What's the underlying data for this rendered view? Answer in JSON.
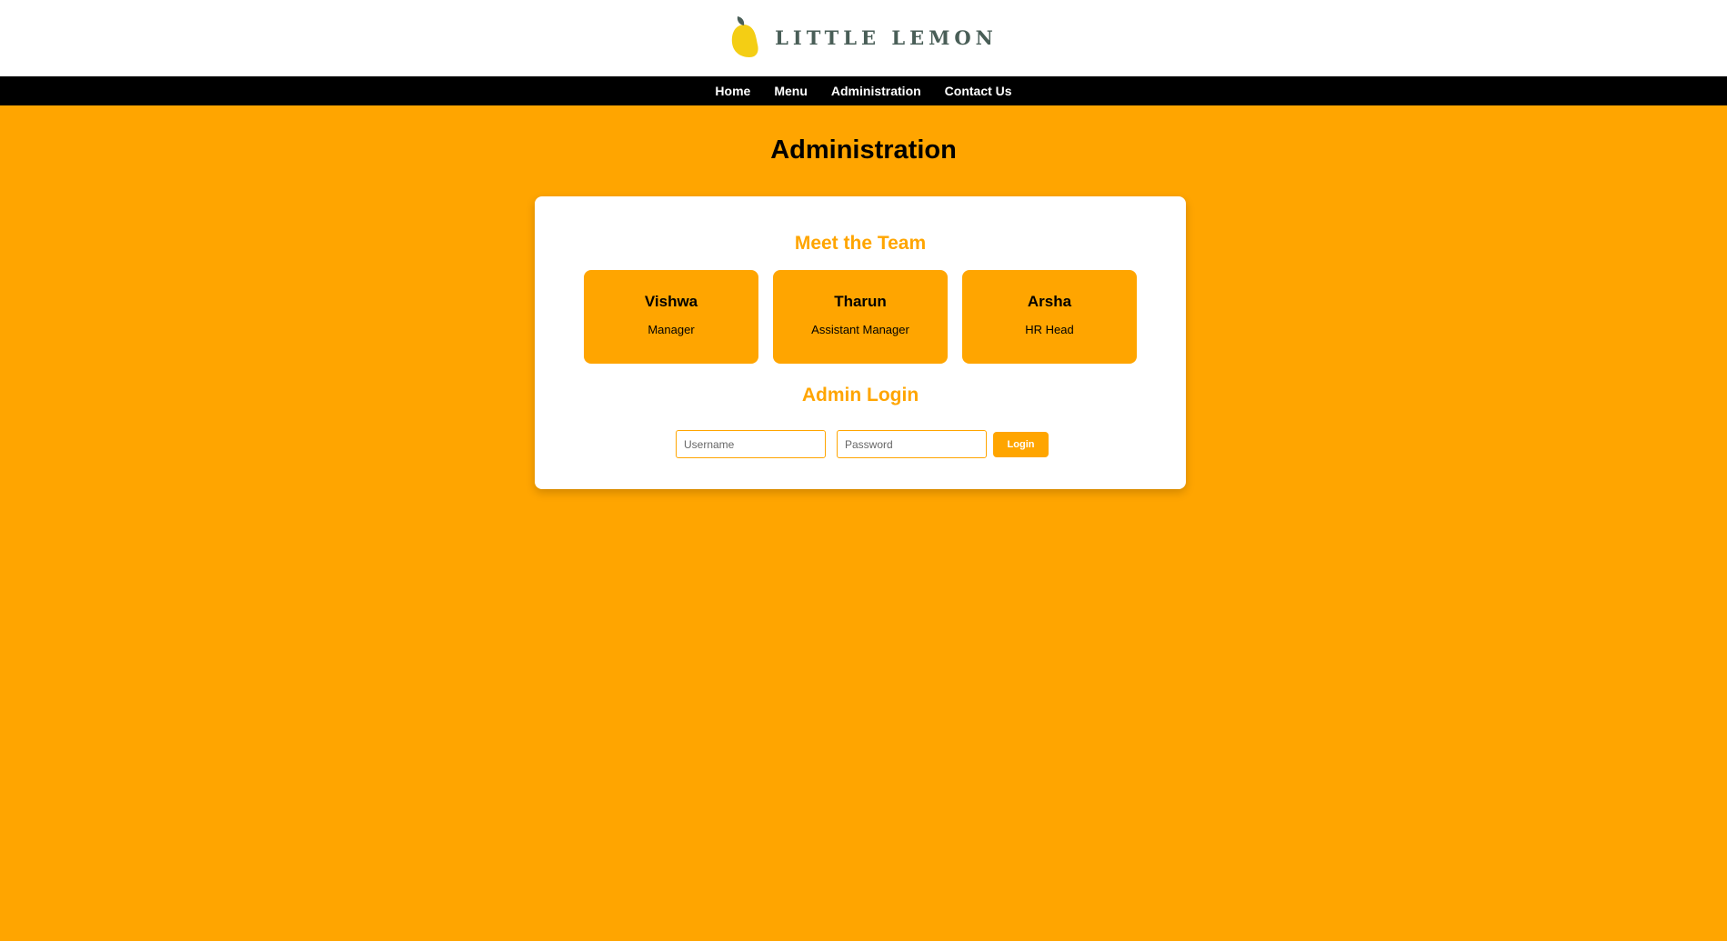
{
  "brand": {
    "name": "LITTLE LEMON"
  },
  "nav": [
    {
      "label": "Home"
    },
    {
      "label": "Menu"
    },
    {
      "label": "Administration"
    },
    {
      "label": "Contact Us"
    }
  ],
  "page": {
    "title": "Administration"
  },
  "team": {
    "title": "Meet the Team",
    "members": [
      {
        "name": "Vishwa",
        "role": "Manager"
      },
      {
        "name": "Tharun",
        "role": "Assistant Manager"
      },
      {
        "name": "Arsha",
        "role": "HR Head"
      }
    ]
  },
  "login": {
    "title": "Admin Login",
    "username_placeholder": "Username",
    "password_placeholder": "Password",
    "button_label": "Login"
  },
  "colors": {
    "accent": "#FFA500",
    "nav_background": "#000000",
    "brand_text": "#495E57",
    "lemon": "#F4CE14"
  }
}
